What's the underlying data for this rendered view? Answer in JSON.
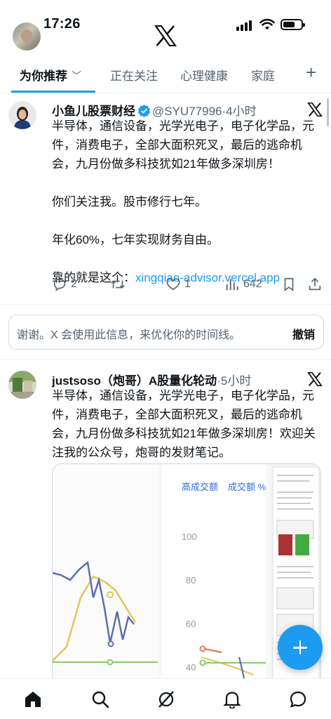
{
  "status_bar": {
    "time": "17:26"
  },
  "tabs": [
    {
      "label": "为你推荐",
      "active": true
    },
    {
      "label": "正在关注"
    },
    {
      "label": "心理健康"
    },
    {
      "label": "家庭"
    }
  ],
  "posts": [
    {
      "author": "小鱼儿股票财经",
      "handle": "@SYU77996",
      "separator": "·",
      "time_ago": "4小时",
      "verified": true,
      "paragraphs": [
        "半导体，通信设备，光学光电子，电子化学品，元件，消费电子，全部大面积死叉，最后的逃命机会，九月份做多科技犹如21年做多深圳房！",
        "你们关注我。股市修行七年。",
        "年化60%，七年实现财务自由。"
      ],
      "link_prefix": "靠的就是这个：",
      "link_text": "xingqiao-advisor.vercel.app",
      "actions": {
        "replies": "2",
        "reposts": "",
        "likes": "1",
        "views": "642"
      }
    },
    {
      "author": "justsoso（炮哥）A股量化轮动",
      "separator": "·",
      "time_ago": "5小时",
      "text": "半导体，通信设备，光学光电子，电子化学品，元件，消费电子，全部大面积死叉，最后的逃命机会，九月份做多科技犹如21年做多深圳房！欢迎关注我的公众号，炮哥的发财笔记。",
      "media_chart": {
        "legend_1": "高成交额",
        "legend_2": "成交额 %",
        "y_ticks": [
          "100",
          "80",
          "60",
          "40"
        ]
      }
    }
  ],
  "feedback": {
    "message": "谢谢。X 会使用此信息，来优化你的时间线。",
    "undo_label": "撤销"
  },
  "colors": {
    "accent": "#1d9bf0",
    "text": "#0f1419",
    "muted": "#536471"
  },
  "bottom_nav": [
    "home-icon",
    "search-icon",
    "grok-icon",
    "notifications-icon",
    "messages-icon"
  ]
}
